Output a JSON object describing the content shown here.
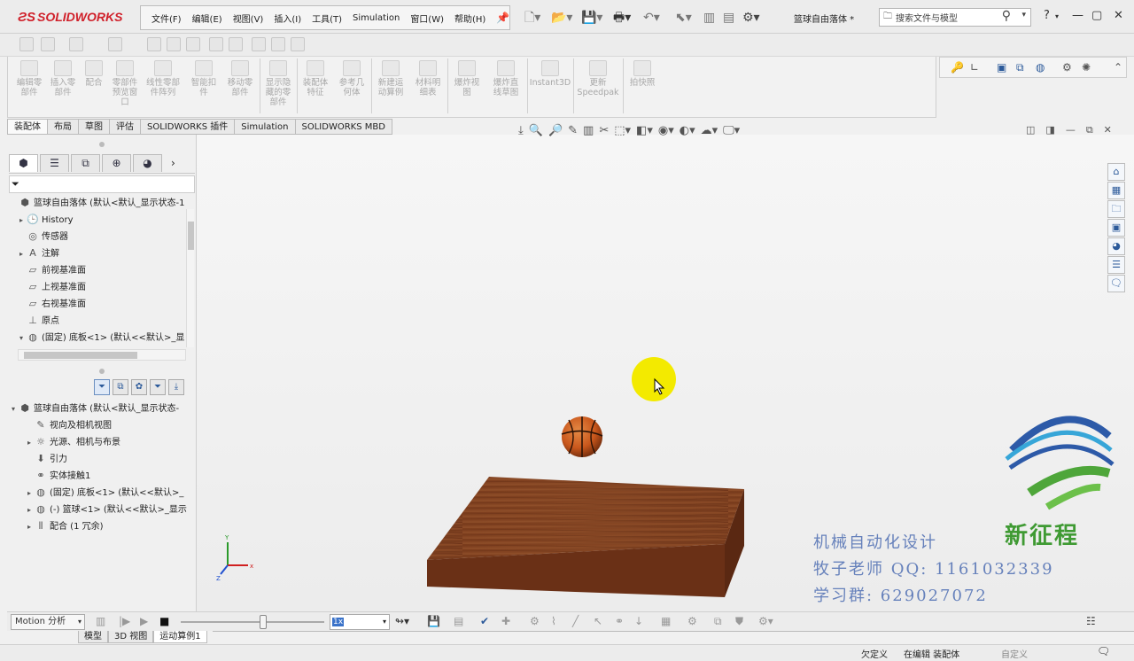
{
  "app": {
    "name": "SOLIDWORKS",
    "document_title": "篮球自由落体 *"
  },
  "menu": [
    "文件(F)",
    "编辑(E)",
    "视图(V)",
    "插入(I)",
    "工具(T)",
    "Simulation",
    "窗口(W)",
    "帮助(H)"
  ],
  "search": {
    "placeholder": "搜索文件与模型"
  },
  "window_controls": {
    "help": "?",
    "minimize": "—",
    "maximize": "▢",
    "close": "✕"
  },
  "commands": [
    "编辑零\n部件",
    "插入零\n部件",
    "配合",
    "零部件\n预览窗\n口",
    "线性零部\n件阵列",
    "智能扣\n件",
    "移动零\n部件",
    "显示隐\n藏的零\n部件",
    "装配体\n特征",
    "参考几\n何体",
    "新建运\n动算例",
    "材料明\n细表",
    "爆炸视\n图",
    "爆炸直\n线草图",
    "Instant3D",
    "更新\nSpeedpak",
    "拍快照"
  ],
  "tabs": [
    "装配体",
    "布局",
    "草图",
    "评估",
    "SOLIDWORKS 插件",
    "Simulation",
    "SOLIDWORKS MBD"
  ],
  "active_tab": "装配体",
  "feature_tree": [
    {
      "label": "篮球自由落体  (默认<默认_显示状态-1",
      "icon": "assembly-icon",
      "arrow": "",
      "indent": 0
    },
    {
      "label": "History",
      "icon": "history-icon",
      "arrow": "▸",
      "indent": 1
    },
    {
      "label": "传感器",
      "icon": "sensor-icon",
      "arrow": "",
      "indent": 1
    },
    {
      "label": "注解",
      "icon": "annotation-icon",
      "arrow": "▸",
      "indent": 1
    },
    {
      "label": "前视基准面",
      "icon": "plane-icon",
      "arrow": "",
      "indent": 1
    },
    {
      "label": "上视基准面",
      "icon": "plane-icon",
      "arrow": "",
      "indent": 1
    },
    {
      "label": "右视基准面",
      "icon": "plane-icon",
      "arrow": "",
      "indent": 1
    },
    {
      "label": "原点",
      "icon": "origin-icon",
      "arrow": "",
      "indent": 1
    },
    {
      "label": "(固定) 底板<1> (默认<<默认>_显",
      "icon": "part-icon",
      "arrow": "▾",
      "indent": 1
    }
  ],
  "motion_tree": [
    {
      "label": "篮球自由落体  (默认<默认_显示状态-",
      "icon": "assembly-icon",
      "arrow": "▾",
      "indent": 0
    },
    {
      "label": "视向及相机视图",
      "icon": "camera-icon",
      "arrow": "",
      "indent": 2
    },
    {
      "label": "光源、相机与布景",
      "icon": "light-icon",
      "arrow": "▸",
      "indent": 2
    },
    {
      "label": "引力",
      "icon": "gravity-icon",
      "arrow": "",
      "indent": 2
    },
    {
      "label": "实体接触1",
      "icon": "contact-icon",
      "arrow": "",
      "indent": 2
    },
    {
      "label": "(固定) 底板<1> (默认<<默认>_",
      "icon": "part-icon",
      "arrow": "▸",
      "indent": 2
    },
    {
      "label": "(-) 篮球<1> (默认<<默认>_显示",
      "icon": "part-icon",
      "arrow": "▸",
      "indent": 2
    },
    {
      "label": "配合 (1 冗余)",
      "icon": "mate-icon",
      "arrow": "▸",
      "indent": 2
    }
  ],
  "motion": {
    "study_type": "Motion 分析",
    "speed": "1x",
    "timeline_position": 0.58
  },
  "bottom_tabs": [
    "模型",
    "3D 视图",
    "运动算例1"
  ],
  "active_bottom_tab": "运动算例1",
  "status": {
    "definition": "欠定义",
    "mode": "在编辑 装配体",
    "units": "自定义"
  },
  "watermark": {
    "line1": "机械自动化设计",
    "line2": "牧子老师 QQ: 1161032339",
    "line3": "学习群: 629027072",
    "brand": "新征程"
  },
  "triad": {
    "x": "x",
    "y": "Y",
    "z": "Z"
  },
  "colors": {
    "accent": "#2a6ad1",
    "brand_red": "#d0202a",
    "wood": "#7a3a1a",
    "ball": "#c9571c",
    "cursor_highlight": "#f3ea00"
  }
}
